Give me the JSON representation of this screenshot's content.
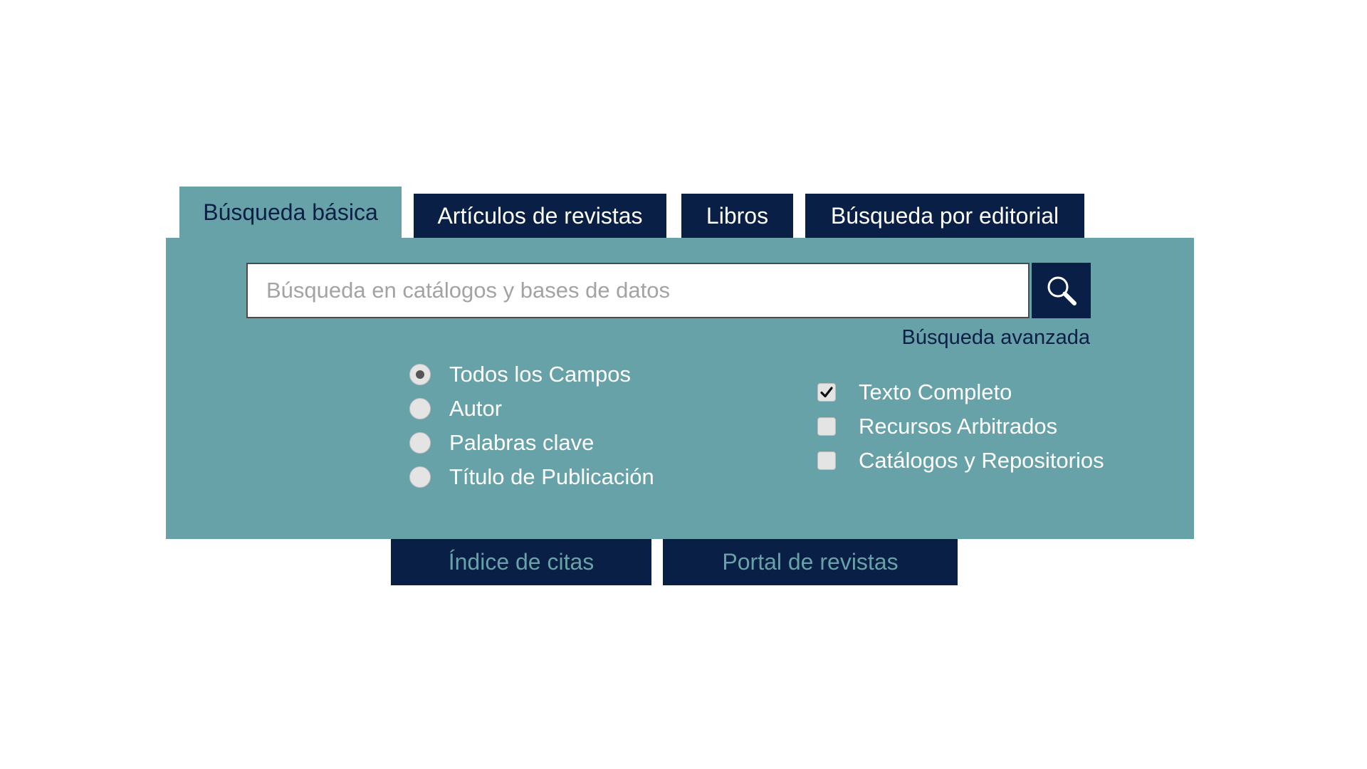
{
  "tabs": [
    {
      "label": "Búsqueda básica",
      "active": true
    },
    {
      "label": "Artículos de revistas",
      "active": false
    },
    {
      "label": "Libros",
      "active": false
    },
    {
      "label": "Búsqueda por editorial",
      "active": false
    }
  ],
  "search": {
    "placeholder": "Búsqueda en catálogos y bases de datos",
    "value": "",
    "button_icon": "search-icon",
    "advanced_label": "Búsqueda avanzada"
  },
  "fields": {
    "selected": "Todos los Campos",
    "options": [
      {
        "label": "Todos los Campos",
        "checked": true
      },
      {
        "label": "Autor",
        "checked": false
      },
      {
        "label": "Palabras clave",
        "checked": false
      },
      {
        "label": "Título de Publicación",
        "checked": false
      }
    ]
  },
  "filters": [
    {
      "label": "Texto Completo",
      "checked": true
    },
    {
      "label": "Recursos Arbitrados",
      "checked": false
    },
    {
      "label": "Catálogos y Repositorios",
      "checked": false
    }
  ],
  "bottom_buttons": [
    {
      "label": "Índice de citas"
    },
    {
      "label": "Portal de revistas"
    }
  ],
  "colors": {
    "navy": "#0a1f45",
    "teal": "#67a2a8",
    "white": "#ffffff"
  }
}
